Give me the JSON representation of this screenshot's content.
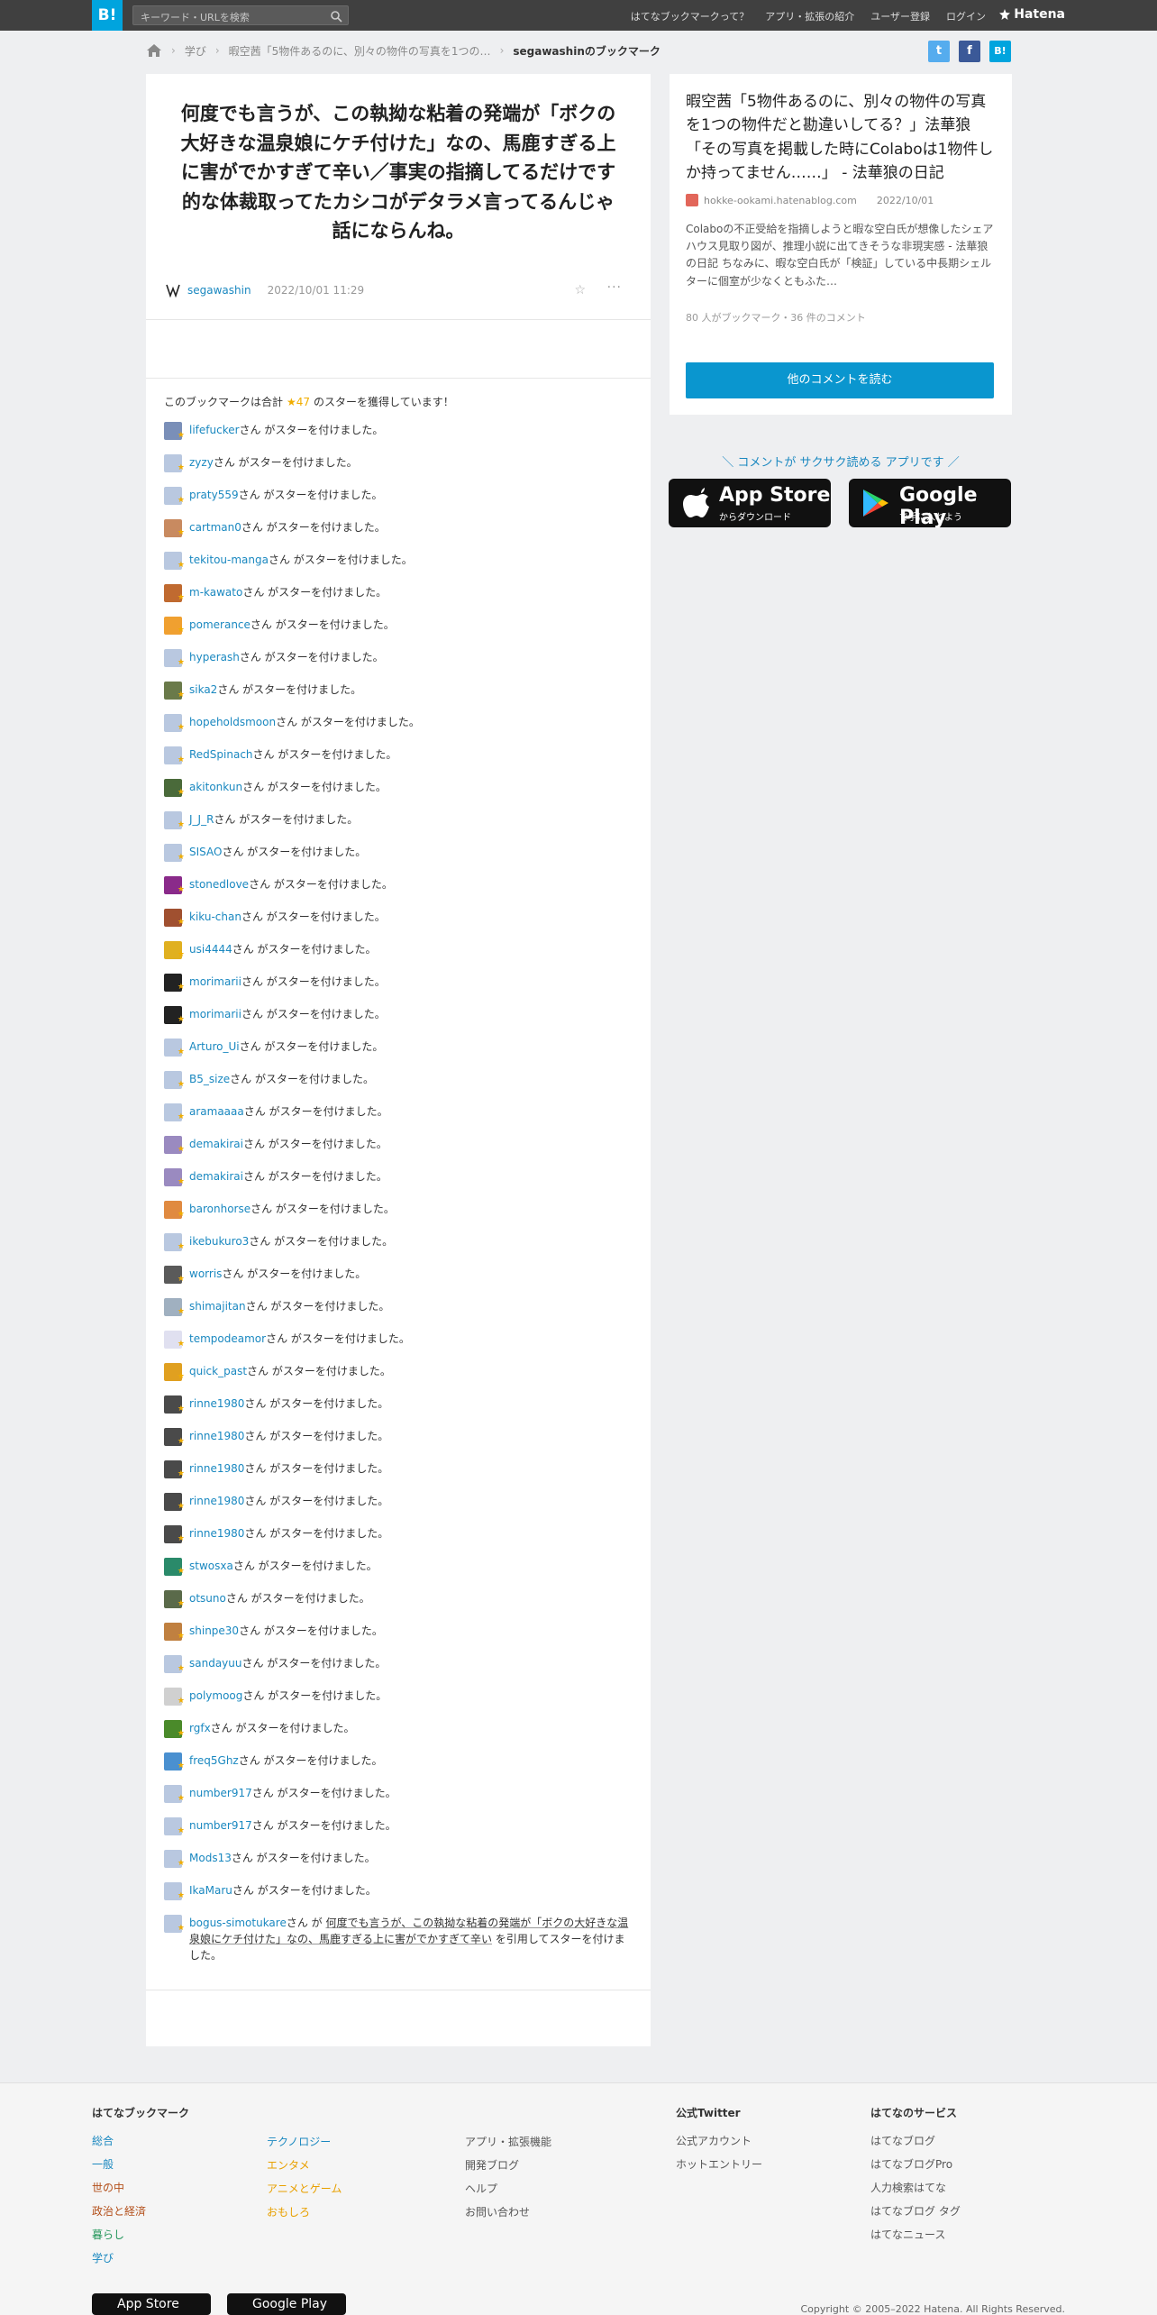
{
  "topbar": {
    "logo": "B!",
    "search_placeholder": "キーワード・URLを検索",
    "nav": [
      "はてなブックマークって？",
      "アプリ・拡張の紹介",
      "ユーザー登録",
      "ログイン"
    ],
    "brand": "Hatena"
  },
  "breadcrumb": [
    "学び",
    "暇空茜「5物件あるのに、別々の物件の写真を1つの…",
    "segawashinのブックマーク"
  ],
  "share": {
    "twitter": "t",
    "facebook": "f",
    "hatena": "B!"
  },
  "comment": {
    "text": "何度でも言うが、この執拗な粘着の発端が「ボクの大好きな温泉娘にケチ付けた」なの、馬鹿すぎる上に害がでかすぎて辛い／事実の指摘してるだけです的な体裁取ってたカシコがデタラメ言ってるんじゃ話にならんね。",
    "user": "segawashin",
    "date": "2022/10/01 11:29",
    "more": "···"
  },
  "summary": {
    "prefix": "このブックマークは合計",
    "count": "★47",
    "suffix": "のスターを獲得しています！"
  },
  "star_suffix": "さん がスターを付けました。",
  "stars": [
    {
      "user": "lifefucker",
      "color": "#7a8fb8"
    },
    {
      "user": "zyzy",
      "color": "#b9c8e0"
    },
    {
      "user": "praty559",
      "color": "#b9c8e0"
    },
    {
      "user": "cartman0",
      "color": "#c88a60"
    },
    {
      "user": "tekitou-manga",
      "color": "#b9c8e0"
    },
    {
      "user": "m-kawato",
      "color": "#c06a30"
    },
    {
      "user": "pomerance",
      "color": "#f0a030"
    },
    {
      "user": "hyperash",
      "color": "#b9c8e0"
    },
    {
      "user": "sika2",
      "color": "#6a7a4a"
    },
    {
      "user": "hopeholdsmoon",
      "color": "#b9c8e0"
    },
    {
      "user": "RedSpinach",
      "color": "#b9c8e0"
    },
    {
      "user": "akitonkun",
      "color": "#4a6a3a"
    },
    {
      "user": "J_J_R",
      "color": "#b9c8e0"
    },
    {
      "user": "SISAO",
      "color": "#b9c8e0"
    },
    {
      "user": "stonedlove",
      "color": "#8a2a8a"
    },
    {
      "user": "kiku-chan",
      "color": "#a05030"
    },
    {
      "user": "usi4444",
      "color": "#e0b020"
    },
    {
      "user": "morimarii",
      "color": "#222222"
    },
    {
      "user": "morimarii",
      "color": "#222222"
    },
    {
      "user": "Arturo_Ui",
      "color": "#b9c8e0"
    },
    {
      "user": "B5_size",
      "color": "#b9c8e0"
    },
    {
      "user": "aramaaaa",
      "color": "#b9c8e0"
    },
    {
      "user": "demakirai",
      "color": "#9a8ac0"
    },
    {
      "user": "demakirai",
      "color": "#9a8ac0"
    },
    {
      "user": "baronhorse",
      "color": "#e08a40"
    },
    {
      "user": "ikebukuro3",
      "color": "#b9c8e0"
    },
    {
      "user": "worris",
      "color": "#5a5a5a"
    },
    {
      "user": "shimajitan",
      "color": "#a0b0c0"
    },
    {
      "user": "tempodeamor",
      "color": "#e0e0f0"
    },
    {
      "user": "quick_past",
      "color": "#e0a020"
    },
    {
      "user": "rinne1980",
      "color": "#4a4a4a"
    },
    {
      "user": "rinne1980",
      "color": "#4a4a4a"
    },
    {
      "user": "rinne1980",
      "color": "#4a4a4a"
    },
    {
      "user": "rinne1980",
      "color": "#4a4a4a"
    },
    {
      "user": "rinne1980",
      "color": "#4a4a4a"
    },
    {
      "user": "stwosxa",
      "color": "#2a8a6a"
    },
    {
      "user": "otsuno",
      "color": "#5a6a4a"
    },
    {
      "user": "shinpe30",
      "color": "#c08040"
    },
    {
      "user": "sandayuu",
      "color": "#b9c8e0"
    },
    {
      "user": "polymoog",
      "color": "#d0d0d0"
    },
    {
      "user": "rgfx",
      "color": "#4a8a2a"
    },
    {
      "user": "freq5Ghz",
      "color": "#4a90d0"
    },
    {
      "user": "number917",
      "color": "#b9c8e0"
    },
    {
      "user": "number917",
      "color": "#b9c8e0"
    },
    {
      "user": "Mods13",
      "color": "#b9c8e0"
    },
    {
      "user": "IkaMaru",
      "color": "#b9c8e0"
    }
  ],
  "last_star": {
    "user": "bogus-simotukare",
    "color": "#b9c8e0",
    "pre": "さん が",
    "quote": "何度でも言うが、この執拗な粘着の発端が「ボクの大好きな温泉娘にケチ付けた」なの、馬鹿すぎる上に害がでかすぎて辛い",
    "post": "を引用してスターを付けました。"
  },
  "entry": {
    "title": "暇空茜「5物件あるのに、別々の物件の写真を1つの物件だと勘違いしてる？」法華狼「その写真を掲載した時にColaboは1物件しか持ってません……」 - 法華狼の日記",
    "domain": "hokke-ookami.hatenablog.com",
    "date": "2022/10/01",
    "desc": "Colaboの不正受給を指摘しようと暇な空白氏が想像したシェアハウス見取り図が、推理小説に出てきそうな非現実感 - 法華狼の日記 ちなみに、暇な空白氏が「検証」している中長期シェルターに個室が少なくともふた…",
    "counts": "80 人がブックマーク・36 件のコメント",
    "read_more": "他のコメントを読む"
  },
  "promo": {
    "text": "＼ コメントが サクサク読める アプリです ／",
    "appstore_big": "App Store",
    "appstore_small": "からダウンロード",
    "gplay_big": "Google Play",
    "gplay_small": "で手に入れよう"
  },
  "footer": {
    "col1_title": "はてなブックマーク",
    "col1": [
      {
        "t": "総合",
        "c": "b"
      },
      {
        "t": "一般",
        "c": "b"
      },
      {
        "t": "世の中",
        "c": "r"
      },
      {
        "t": "政治と経済",
        "c": "r"
      },
      {
        "t": "暮らし",
        "c": "g"
      },
      {
        "t": "学び",
        "c": "b"
      }
    ],
    "col2": [
      {
        "t": "テクノロジー",
        "c": "b"
      },
      {
        "t": "エンタメ",
        "c": "o"
      },
      {
        "t": "アニメとゲーム",
        "c": "o"
      },
      {
        "t": "おもしろ",
        "c": "o"
      }
    ],
    "col3": [
      "アプリ・拡張機能",
      "開発ブログ",
      "ヘルプ",
      "お問い合わせ"
    ],
    "col4_title": "公式Twitter",
    "col4": [
      "公式アカウント",
      "ホットエントリー"
    ],
    "col5_title": "はてなのサービス",
    "col5": [
      "はてなブログ",
      "はてなブログPro",
      "人力検索はてな",
      "はてなブログ タグ",
      "はてなニュース"
    ],
    "copyright": "Copyright © 2005–2022 Hatena. All Rights Reserved.",
    "appstore": "App Store",
    "gplay": "Google Play"
  }
}
